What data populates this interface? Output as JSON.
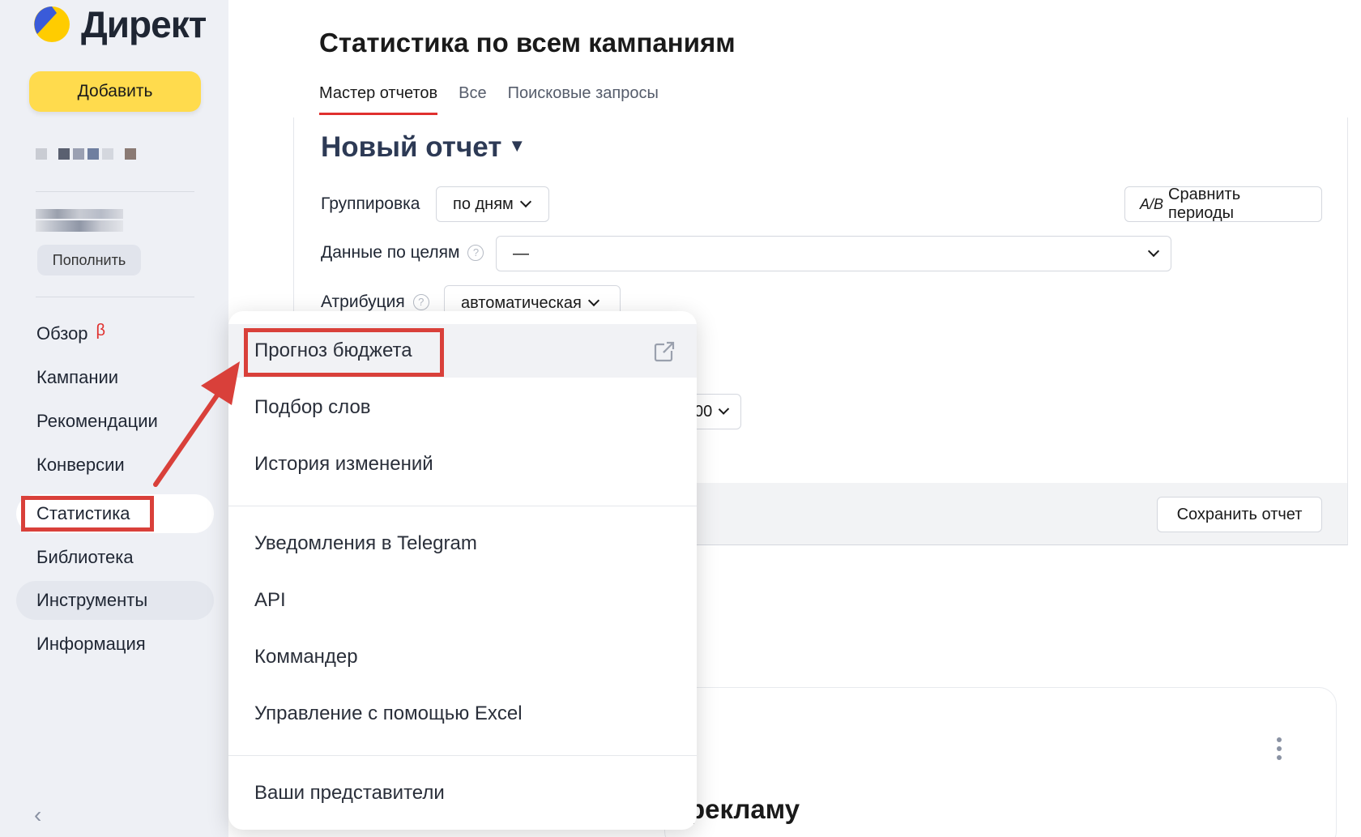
{
  "sidebar": {
    "logo_text": "Директ",
    "add_label": "Добавить",
    "topup_label": "Пополнить",
    "nav": [
      {
        "label": "Обзор",
        "badge": "β"
      },
      {
        "label": "Кампании"
      },
      {
        "label": "Рекомендации"
      },
      {
        "label": "Конверсии"
      },
      {
        "label": "Статистика"
      },
      {
        "label": "Библиотека"
      },
      {
        "label": "Инструменты"
      },
      {
        "label": "Информация"
      }
    ],
    "collapse_icon": "‹"
  },
  "main": {
    "title": "Статистика по всем кампаниям",
    "tabs": [
      {
        "label": "Мастер отчетов",
        "active": true
      },
      {
        "label": "Все"
      },
      {
        "label": "Поисковые запросы"
      }
    ],
    "report_title": "Новый отчет",
    "report_caret": "▼",
    "grouping_label": "Группировка",
    "grouping_value": "по дням",
    "compare_label": "Сравнить периоды",
    "compare_icon": "A/B",
    "goals_label": "Данные по целям",
    "goals_value": "—",
    "attribution_label": "Атрибуция",
    "attribution_value": "автоматическая",
    "partial_select": "00",
    "save_label": "Сохранить отчет",
    "card_text_partial": "рекламу",
    "help_glyph": "?"
  },
  "menu": {
    "items": [
      {
        "label": "Прогноз бюджета",
        "external": true
      },
      {
        "label": "Подбор слов"
      },
      {
        "label": "История изменений"
      },
      {
        "label": "Уведомления в Telegram"
      },
      {
        "label": "API"
      },
      {
        "label": "Коммандер"
      },
      {
        "label": "Управление с помощью Excel"
      },
      {
        "label": "Ваши представители"
      }
    ]
  },
  "colors": {
    "accent_yellow": "#ffdb4d",
    "highlight_red": "#d9403a",
    "tab_underline": "#e0302e",
    "sidebar_bg": "#eef0f5"
  }
}
